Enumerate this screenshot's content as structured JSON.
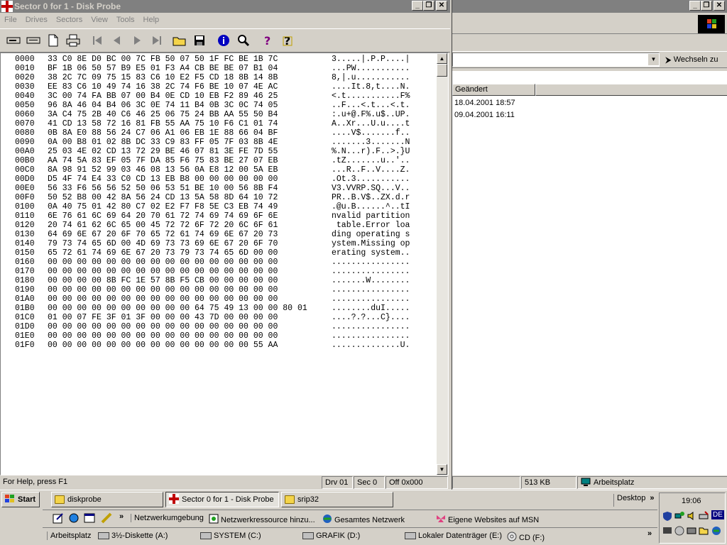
{
  "window": {
    "title": "Sector 0 for 1 - Disk Probe",
    "menu": [
      "File",
      "Drives",
      "Sectors",
      "View",
      "Tools",
      "Help"
    ]
  },
  "hex_rows": [
    {
      "offset": "0000",
      "hex": "33 C0 8E D0 BC 00 7C FB 50 07 50 1F FC BE 1B 7C",
      "ascii": "3.....|.P.P....|"
    },
    {
      "offset": "0010",
      "hex": "BF 1B 06 50 57 B9 E5 01 F3 A4 CB BE BE 07 B1 04",
      "ascii": "...PW..........."
    },
    {
      "offset": "0020",
      "hex": "38 2C 7C 09 75 15 83 C6 10 E2 F5 CD 18 8B 14 8B",
      "ascii": "8,|.u..........."
    },
    {
      "offset": "0030",
      "hex": "EE 83 C6 10 49 74 16 38 2C 74 F6 BE 10 07 4E AC",
      "ascii": "....It.8,t....N."
    },
    {
      "offset": "0040",
      "hex": "3C 00 74 FA BB 07 00 B4 0E CD 10 EB F2 89 46 25",
      "ascii": "<.t...........F%"
    },
    {
      "offset": "0050",
      "hex": "96 8A 46 04 B4 06 3C 0E 74 11 B4 0B 3C 0C 74 05",
      "ascii": "..F...<.t...<.t."
    },
    {
      "offset": "0060",
      "hex": "3A C4 75 2B 40 C6 46 25 06 75 24 BB AA 55 50 B4",
      "ascii": ":.u+@.F%.u$..UP."
    },
    {
      "offset": "0070",
      "hex": "41 CD 13 58 72 16 81 FB 55 AA 75 10 F6 C1 01 74",
      "ascii": "A..Xr...U.u....t"
    },
    {
      "offset": "0080",
      "hex": "0B 8A E0 88 56 24 C7 06 A1 06 EB 1E 88 66 04 BF",
      "ascii": "....V$.......f.."
    },
    {
      "offset": "0090",
      "hex": "0A 00 B8 01 02 8B DC 33 C9 83 FF 05 7F 03 8B 4E",
      "ascii": ".......3.......N"
    },
    {
      "offset": "00A0",
      "hex": "25 03 4E 02 CD 13 72 29 BE 46 07 81 3E FE 7D 55",
      "ascii": "%.N...r).F..>.}U"
    },
    {
      "offset": "00B0",
      "hex": "AA 74 5A 83 EF 05 7F DA 85 F6 75 83 BE 27 07 EB",
      "ascii": ".tZ.......u..'.."
    },
    {
      "offset": "00C0",
      "hex": "8A 98 91 52 99 03 46 08 13 56 0A E8 12 00 5A EB",
      "ascii": "...R..F..V....Z."
    },
    {
      "offset": "00D0",
      "hex": "D5 4F 74 E4 33 C0 CD 13 EB B8 00 00 00 00 00 00",
      "ascii": ".Ot.3..........."
    },
    {
      "offset": "00E0",
      "hex": "56 33 F6 56 56 52 50 06 53 51 BE 10 00 56 8B F4",
      "ascii": "V3.VVRP.SQ...V.."
    },
    {
      "offset": "00F0",
      "hex": "50 52 B8 00 42 8A 56 24 CD 13 5A 58 8D 64 10 72",
      "ascii": "PR..B.V$..ZX.d.r"
    },
    {
      "offset": "0100",
      "hex": "0A 40 75 01 42 80 C7 02 E2 F7 F8 5E C3 EB 74 49",
      "ascii": ".@u.B......^..tI"
    },
    {
      "offset": "0110",
      "hex": "6E 76 61 6C 69 64 20 70 61 72 74 69 74 69 6F 6E",
      "ascii": "nvalid partition"
    },
    {
      "offset": "0120",
      "hex": "20 74 61 62 6C 65 00 45 72 72 6F 72 20 6C 6F 61",
      "ascii": " table.Error loa"
    },
    {
      "offset": "0130",
      "hex": "64 69 6E 67 20 6F 70 65 72 61 74 69 6E 67 20 73",
      "ascii": "ding operating s"
    },
    {
      "offset": "0140",
      "hex": "79 73 74 65 6D 00 4D 69 73 73 69 6E 67 20 6F 70",
      "ascii": "ystem.Missing op"
    },
    {
      "offset": "0150",
      "hex": "65 72 61 74 69 6E 67 20 73 79 73 74 65 6D 00 00",
      "ascii": "erating system.."
    },
    {
      "offset": "0160",
      "hex": "00 00 00 00 00 00 00 00 00 00 00 00 00 00 00 00",
      "ascii": "................"
    },
    {
      "offset": "0170",
      "hex": "00 00 00 00 00 00 00 00 00 00 00 00 00 00 00 00",
      "ascii": "................"
    },
    {
      "offset": "0180",
      "hex": "00 00 00 00 8B FC 1E 57 8B F5 CB 00 00 00 00 00",
      "ascii": ".......W........"
    },
    {
      "offset": "0190",
      "hex": "00 00 00 00 00 00 00 00 00 00 00 00 00 00 00 00",
      "ascii": "................"
    },
    {
      "offset": "01A0",
      "hex": "00 00 00 00 00 00 00 00 00 00 00 00 00 00 00 00",
      "ascii": "................"
    },
    {
      "offset": "01B0",
      "hex": "00 00 00 00 00 00 00 00 00 00 64 75 49 13 00 00 80 01",
      "ascii": "........duI....."
    },
    {
      "offset": "01C0",
      "hex": "01 00 07 FE 3F 01 3F 00 00 00 43 7D 00 00 00 00",
      "ascii": "....?.?...C}...."
    },
    {
      "offset": "01D0",
      "hex": "00 00 00 00 00 00 00 00 00 00 00 00 00 00 00 00",
      "ascii": "................"
    },
    {
      "offset": "01E0",
      "hex": "00 00 00 00 00 00 00 00 00 00 00 00 00 00 00 00",
      "ascii": "................"
    },
    {
      "offset": "01F0",
      "hex": "00 00 00 00 00 00 00 00 00 00 00 00 00 00 55 AA",
      "ascii": "..............U."
    }
  ],
  "status": {
    "help": "For Help, press F1",
    "drive": "Drv  01",
    "sector": "Sec 0",
    "offset": "Off 0x000"
  },
  "explorer": {
    "go_button": "Wechseln zu",
    "column_header": "Geändert",
    "rows": [
      "18.04.2001 18:57",
      "09.04.2001 16:11"
    ],
    "status_size": "513 KB",
    "status_location": "Arbeitsplatz"
  },
  "taskbar": {
    "start_label": "Start",
    "tasks": [
      "diskprobe",
      "Sector 0 for 1 - Disk Probe",
      "srip32"
    ],
    "desktop_label": "Desktop",
    "clock": "19:06",
    "chevron": "»"
  },
  "links_bar": [
    "Netzwerkumgebung",
    "Netzwerkressource hinzu...",
    "Gesamtes Netzwerk",
    "Eigene Websites auf MSN"
  ],
  "drives_bar": {
    "label": "Arbeitsplatz",
    "drives": [
      "3½-Diskette (A:)",
      "SYSTEM (C:)",
      "GRAFIK (D:)",
      "Lokaler Datenträger (E:)",
      "CD (F:)"
    ]
  },
  "tray_lang": "DE",
  "colors": {
    "desktop_gray": "#d4d0c8",
    "title_inactive": "#808080",
    "link_blue": "#0000ff"
  }
}
